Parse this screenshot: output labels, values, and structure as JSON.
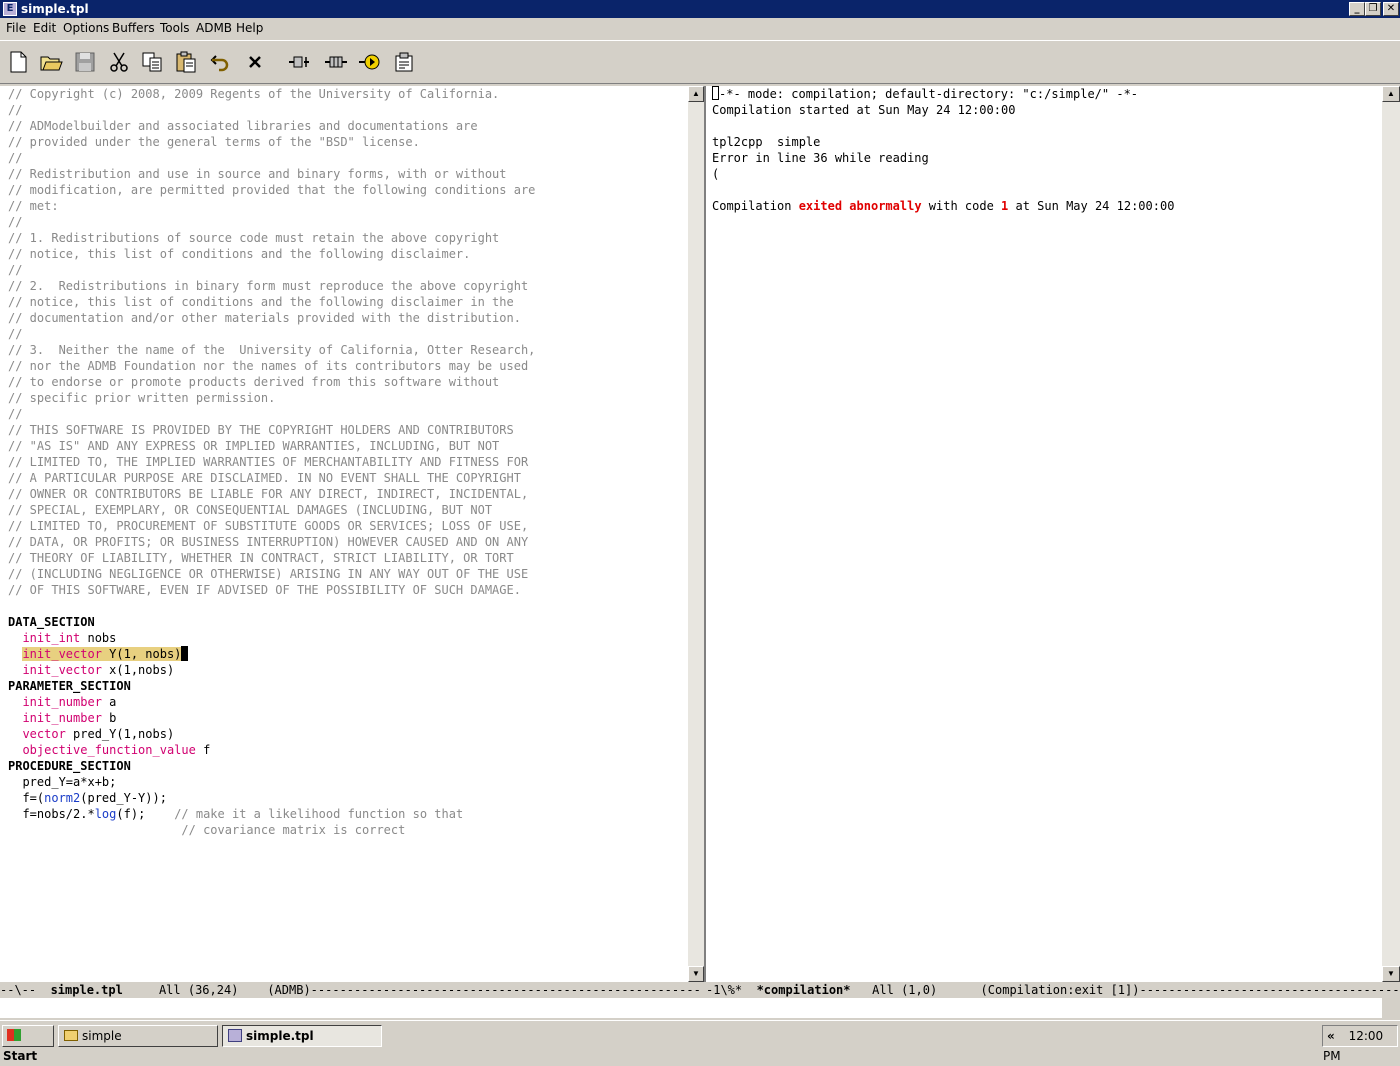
{
  "window": {
    "title": "simple.tpl"
  },
  "menu": [
    "File",
    "Edit",
    "Options",
    "Buffers",
    "Tools",
    "ADMB",
    "Help"
  ],
  "toolbar": {
    "buttons": [
      "new-file",
      "open-folder",
      "save",
      "cut",
      "copy",
      "paste",
      "undo",
      "close",
      "compile",
      "build",
      "run",
      "help"
    ]
  },
  "left_buffer": {
    "comments": [
      "// Copyright (c) 2008, 2009 Regents of the University of California.",
      "//",
      "// ADModelbuilder and associated libraries and documentations are",
      "// provided under the general terms of the \"BSD\" license.",
      "//",
      "// Redistribution and use in source and binary forms, with or without",
      "// modification, are permitted provided that the following conditions are",
      "// met:",
      "//",
      "// 1. Redistributions of source code must retain the above copyright",
      "// notice, this list of conditions and the following disclaimer.",
      "//",
      "// 2.  Redistributions in binary form must reproduce the above copyright",
      "// notice, this list of conditions and the following disclaimer in the",
      "// documentation and/or other materials provided with the distribution.",
      "//",
      "// 3.  Neither the name of the  University of California, Otter Research,",
      "// nor the ADMB Foundation nor the names of its contributors may be used",
      "// to endorse or promote products derived from this software without",
      "// specific prior written permission.",
      "//",
      "// THIS SOFTWARE IS PROVIDED BY THE COPYRIGHT HOLDERS AND CONTRIBUTORS",
      "// \"AS IS\" AND ANY EXPRESS OR IMPLIED WARRANTIES, INCLUDING, BUT NOT",
      "// LIMITED TO, THE IMPLIED WARRANTIES OF MERCHANTABILITY AND FITNESS FOR",
      "// A PARTICULAR PURPOSE ARE DISCLAIMED. IN NO EVENT SHALL THE COPYRIGHT",
      "// OWNER OR CONTRIBUTORS BE LIABLE FOR ANY DIRECT, INDIRECT, INCIDENTAL,",
      "// SPECIAL, EXEMPLARY, OR CONSEQUENTIAL DAMAGES (INCLUDING, BUT NOT",
      "// LIMITED TO, PROCUREMENT OF SUBSTITUTE GOODS OR SERVICES; LOSS OF USE,",
      "// DATA, OR PROFITS; OR BUSINESS INTERRUPTION) HOWEVER CAUSED AND ON ANY",
      "// THEORY OF LIABILITY, WHETHER IN CONTRACT, STRICT LIABILITY, OR TORT",
      "// (INCLUDING NEGLIGENCE OR OTHERWISE) ARISING IN ANY WAY OUT OF THE USE",
      "// OF THIS SOFTWARE, EVEN IF ADVISED OF THE POSSIBILITY OF SUCH DAMAGE."
    ],
    "data_section": "DATA_SECTION",
    "l_init_int": "init_int",
    "l_nobs": " nobs",
    "l_init_vector_1": "init_vector",
    "l_Y": " Y(1, nobs)",
    "l_init_vector_2": "init_vector",
    "l_x": " x(1,nobs)",
    "parameter_section": "PARAMETER_SECTION",
    "l_init_number_a": "init_number",
    "l_a": " a",
    "l_init_number_b": "init_number",
    "l_b": " b",
    "l_vector": "vector",
    "l_pred": " pred_Y(1,nobs)",
    "l_obj": "objective_function_value",
    "l_f": " f",
    "procedure_section": "PROCEDURE_SECTION",
    "l_predY": "  pred_Y=a*x+b;",
    "l_f_eq": "  f=(",
    "l_norm2": "norm2",
    "l_norm_args": "(pred_Y-Y));",
    "l_f2_pre": "  f=nobs/2.*",
    "l_log": "log",
    "l_f2_post": "(f);    ",
    "l_c1": "// make it a likelihood function so that",
    "l_c2_pad": "                        ",
    "l_c2": "// covariance matrix is correct"
  },
  "right_buffer": {
    "line1": "-*- mode: compilation; default-directory: \"c:/simple/\" -*-",
    "line2": "Compilation started at Sun May 24 12:00:00",
    "line3": "tpl2cpp  simple",
    "line4": "Error in line 36 while reading",
    "line5": "(",
    "exit_pre": "Compilation ",
    "exit_word1": "exited",
    "exit_word2": "abnormally",
    "exit_mid": " with code ",
    "exit_code": "1",
    "exit_post": " at Sun May 24 12:00:00"
  },
  "modeline_left": {
    "prefix": "--\\--  ",
    "buffer": "simple.tpl",
    "rest": "     All (36,24)    (ADMB)------------------------------------------------------"
  },
  "modeline_right": {
    "prefix": "-1\\%*  ",
    "buffer": "*compilation*",
    "rest": "   All (1,0)      (Compilation:exit [1])------------------------------------------"
  },
  "taskbar": {
    "start": "Start",
    "task1": "simple",
    "task2": "simple.tpl",
    "tray_chevron": "«",
    "clock": "12:00 PM"
  }
}
